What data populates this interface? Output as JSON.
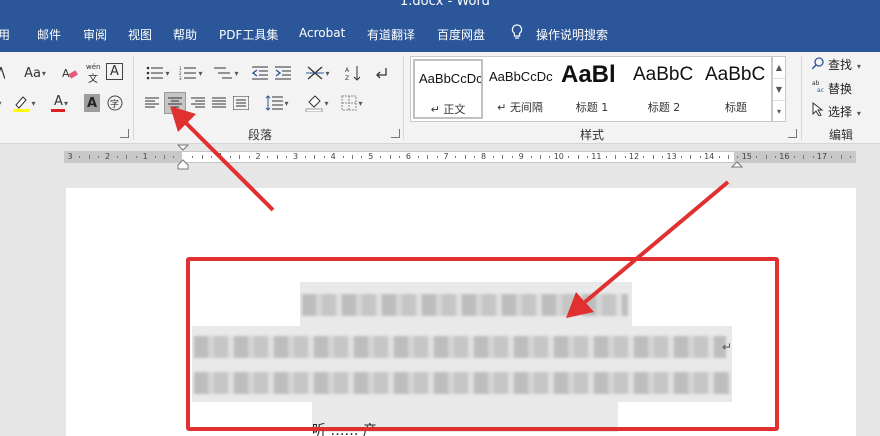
{
  "window": {
    "title": "1.docx - Word"
  },
  "tabs": [
    {
      "label": "引用",
      "display": "用"
    },
    {
      "label": "邮件"
    },
    {
      "label": "审阅"
    },
    {
      "label": "视图"
    },
    {
      "label": "帮助"
    },
    {
      "label": "PDF工具集"
    },
    {
      "label": "Acrobat"
    },
    {
      "label": "有道翻译"
    },
    {
      "label": "百度网盘"
    },
    {
      "label": "操作说明搜索"
    }
  ],
  "font_group": {
    "change_case_label": "Aa",
    "phonetic_label": "wén",
    "border_char_label": "A",
    "font_color_label": "A",
    "char_shading_label": "A",
    "enclose_label": "字"
  },
  "paragraph_group": {
    "label": "段落"
  },
  "styles_group": {
    "label": "样式",
    "items": [
      {
        "preview": "AaBbCcDc",
        "name": "↵ 正文"
      },
      {
        "preview": "AaBbCcDc",
        "name": "↵ 无间隔"
      },
      {
        "preview": "AaBl",
        "name": "标题 1"
      },
      {
        "preview": "AaBbC",
        "name": "标题 2"
      },
      {
        "preview": "AaBbC",
        "name": "标题"
      }
    ]
  },
  "editing_group": {
    "label": "编辑",
    "find_label": "查找",
    "replace_label": "替换",
    "select_label": "选择"
  },
  "ruler": {
    "numbers": [
      "3",
      "2",
      "1",
      "1",
      "2",
      "3",
      "4",
      "5",
      "6",
      "7",
      "8",
      "9",
      "10",
      "11",
      "12",
      "13",
      "14",
      "15",
      "16",
      "17"
    ]
  },
  "document": {
    "tail_text": "听 …… 产"
  },
  "colors": {
    "accent": "#2b579a",
    "annotation_red": "#e03030",
    "highlight": "#ffff00",
    "font_red": "#e02020"
  }
}
